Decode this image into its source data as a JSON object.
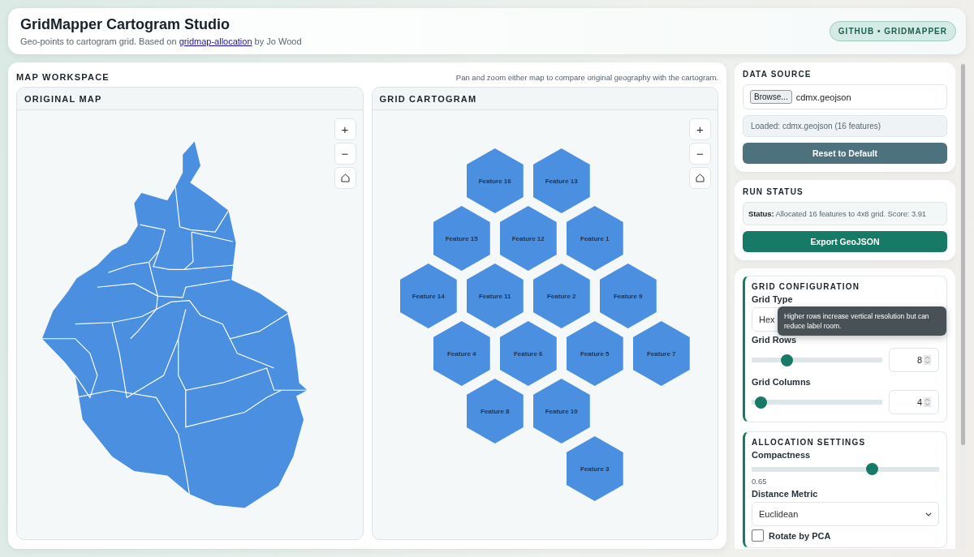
{
  "header": {
    "title": "GridMapper Cartogram Studio",
    "subtitle_before": "Geo-points to cartogram grid. Based on ",
    "subtitle_link": "gridmap-allocation",
    "subtitle_after": " by Jo Wood",
    "badge": "GITHUB • GRIDMAPPER"
  },
  "workspace": {
    "title": "MAP WORKSPACE",
    "hint": "Pan and zoom either map to compare original geography with the cartogram.",
    "panels": [
      {
        "kind": "map",
        "title": "ORIGINAL MAP",
        "zoom_buttons": [
          "+",
          "−"
        ]
      },
      {
        "kind": "cartogram",
        "title": "GRID CARTOGRAM",
        "zoom_buttons": [
          "+",
          "−"
        ]
      }
    ],
    "cartogram_rows": [
      [
        null,
        "Feature 16",
        "Feature 13",
        null
      ],
      [
        "Feature 15",
        "Feature 12",
        "Feature 1",
        null
      ],
      [
        "Feature 14",
        "Feature 11",
        "Feature 2",
        "Feature 9"
      ],
      [
        "Feature 4",
        "Feature 6",
        "Feature 5",
        "Feature 7"
      ],
      [
        null,
        "Feature 8",
        "Feature 10",
        null
      ],
      [
        null,
        null,
        "Feature 3",
        null
      ]
    ]
  },
  "data_source": {
    "title": "DATA SOURCE",
    "browse": "Browse...",
    "file_name": "cdmx.geojson",
    "loaded": "Loaded: cdmx.geojson (16 features)",
    "reset": "Reset to Default"
  },
  "run_status": {
    "title": "RUN STATUS",
    "status": "**Status:** Allocated 16 features to 4x8 grid. Score: 3.91",
    "export": "Export GeoJSON"
  },
  "grid_configuration": {
    "title": "GRID CONFIGURATION",
    "grid_type_label": "Grid Type",
    "grid_type": "Hex",
    "tooltip": "Higher rows increase vertical resolution but can reduce label room.",
    "sliders": [
      {
        "label": "Grid Rows",
        "level": 0.27,
        "value": "8"
      },
      {
        "label": "Grid Columns",
        "level": 0.07,
        "value": "4"
      }
    ]
  },
  "allocation_settings": {
    "title": "ALLOCATION SETTINGS",
    "compactness_label": "Compactness",
    "compactness": {
      "level": 0.64
    },
    "compactness_value": "0.65",
    "metric_label": "Distance Metric",
    "metric": "Euclidean",
    "rotate": {
      "label": "Rotate by PCA",
      "checked": false
    }
  }
}
